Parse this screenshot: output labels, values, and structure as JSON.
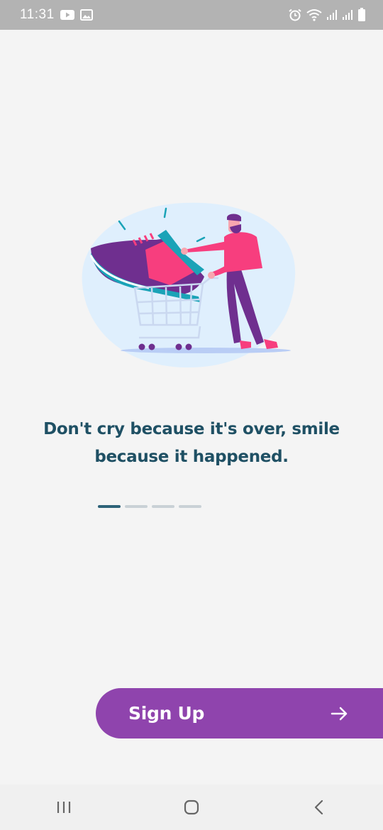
{
  "status_bar": {
    "time": "11:31",
    "icons": [
      "youtube-icon",
      "gallery-icon",
      "alarm-icon",
      "wifi-icon",
      "signal-icon",
      "signal-icon-2",
      "battery-icon"
    ]
  },
  "illustration": {
    "name": "shopping-cart-shoe-illustration",
    "colors": {
      "blob": "#dfeffd",
      "shoe_purple": "#6f2f8f",
      "shoe_pink": "#f73e7e",
      "shoe_teal": "#1aa3b7",
      "person_shirt": "#f73e7e",
      "person_pants": "#6f2f8f",
      "cart": "#cad8f0"
    }
  },
  "onboarding": {
    "quote_line1": "Don't cry because it's over, smile",
    "quote_line2": "because it happened.",
    "page_count": 4,
    "active_page": 1
  },
  "cta": {
    "label": "Sign Up",
    "icon": "arrow-right-icon",
    "color": "#8f44ad"
  },
  "nav_bar": {
    "recents": "recents-icon",
    "home": "home-icon",
    "back": "back-icon"
  },
  "colors": {
    "background": "#f4f4f4",
    "text": "#1f5064",
    "pager_active": "#2d6278",
    "pager_inactive": "#c9d1d6"
  }
}
